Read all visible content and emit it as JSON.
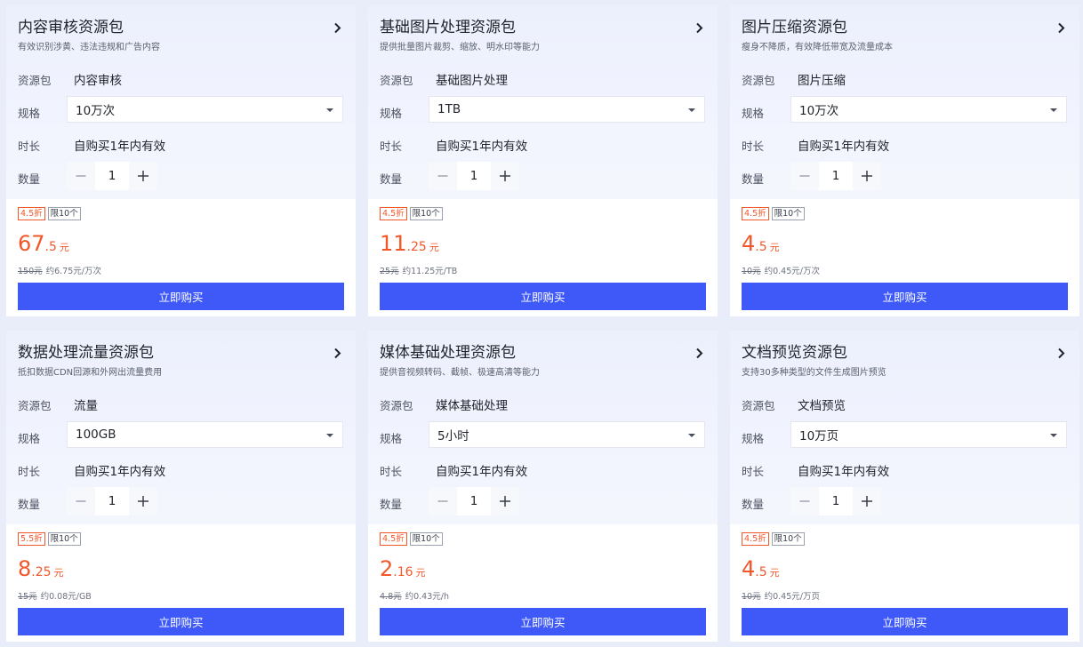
{
  "common": {
    "labels": {
      "package": "资源包",
      "spec": "规格",
      "duration": "时长",
      "quantity": "数量"
    },
    "buy_label": "立即购买"
  },
  "colors": {
    "accent": "#3e59f7",
    "price": "#f2572a"
  },
  "icons": {
    "expand": "chevron-right-icon",
    "dropdown": "caret-down-icon",
    "decrement": "minus-icon",
    "increment": "plus-icon"
  },
  "cards": [
    {
      "title": "内容审核资源包",
      "desc": "有效识别涉黄、违法违规和广告内容",
      "package": "内容审核",
      "spec": "10万次",
      "duration": "自购买1年内有效",
      "quantity": "1",
      "discount": "4.5折",
      "limit": "限10个",
      "price_int": "67",
      "price_dec": ".5",
      "price_unit": "元",
      "orig_price": "150元",
      "unit_price": "约6.75元/万次"
    },
    {
      "title": "基础图片处理资源包",
      "desc": "提供批量图片裁剪、缩放、明水印等能力",
      "package": "基础图片处理",
      "spec": "1TB",
      "duration": "自购买1年内有效",
      "quantity": "1",
      "discount": "4.5折",
      "limit": "限10个",
      "price_int": "11",
      "price_dec": ".25",
      "price_unit": "元",
      "orig_price": "25元",
      "unit_price": "约11.25元/TB"
    },
    {
      "title": "图片压缩资源包",
      "desc": "瘦身不降质，有效降低带宽及流量成本",
      "package": "图片压缩",
      "spec": "10万次",
      "duration": "自购买1年内有效",
      "quantity": "1",
      "discount": "4.5折",
      "limit": "限10个",
      "price_int": "4",
      "price_dec": ".5",
      "price_unit": "元",
      "orig_price": "10元",
      "unit_price": "约0.45元/万次"
    },
    {
      "title": "数据处理流量资源包",
      "desc": "抵扣数据CDN回源和外网出流量费用",
      "package": "流量",
      "spec": "100GB",
      "duration": "自购买1年内有效",
      "quantity": "1",
      "discount": "5.5折",
      "limit": "限10个",
      "price_int": "8",
      "price_dec": ".25",
      "price_unit": "元",
      "orig_price": "15元",
      "unit_price": "约0.08元/GB"
    },
    {
      "title": "媒体基础处理资源包",
      "desc": "提供音视频转码、截帧、极速高清等能力",
      "package": "媒体基础处理",
      "spec": "5小时",
      "duration": "自购买1年内有效",
      "quantity": "1",
      "discount": "4.5折",
      "limit": "限10个",
      "price_int": "2",
      "price_dec": ".16",
      "price_unit": "元",
      "orig_price": "4.8元",
      "unit_price": "约0.43元/h"
    },
    {
      "title": "文档预览资源包",
      "desc": "支持30多种类型的文件生成图片预览",
      "package": "文档预览",
      "spec": "10万页",
      "duration": "自购买1年内有效",
      "quantity": "1",
      "discount": "4.5折",
      "limit": "限10个",
      "price_int": "4",
      "price_dec": ".5",
      "price_unit": "元",
      "orig_price": "10元",
      "unit_price": "约0.45元/万页"
    }
  ]
}
